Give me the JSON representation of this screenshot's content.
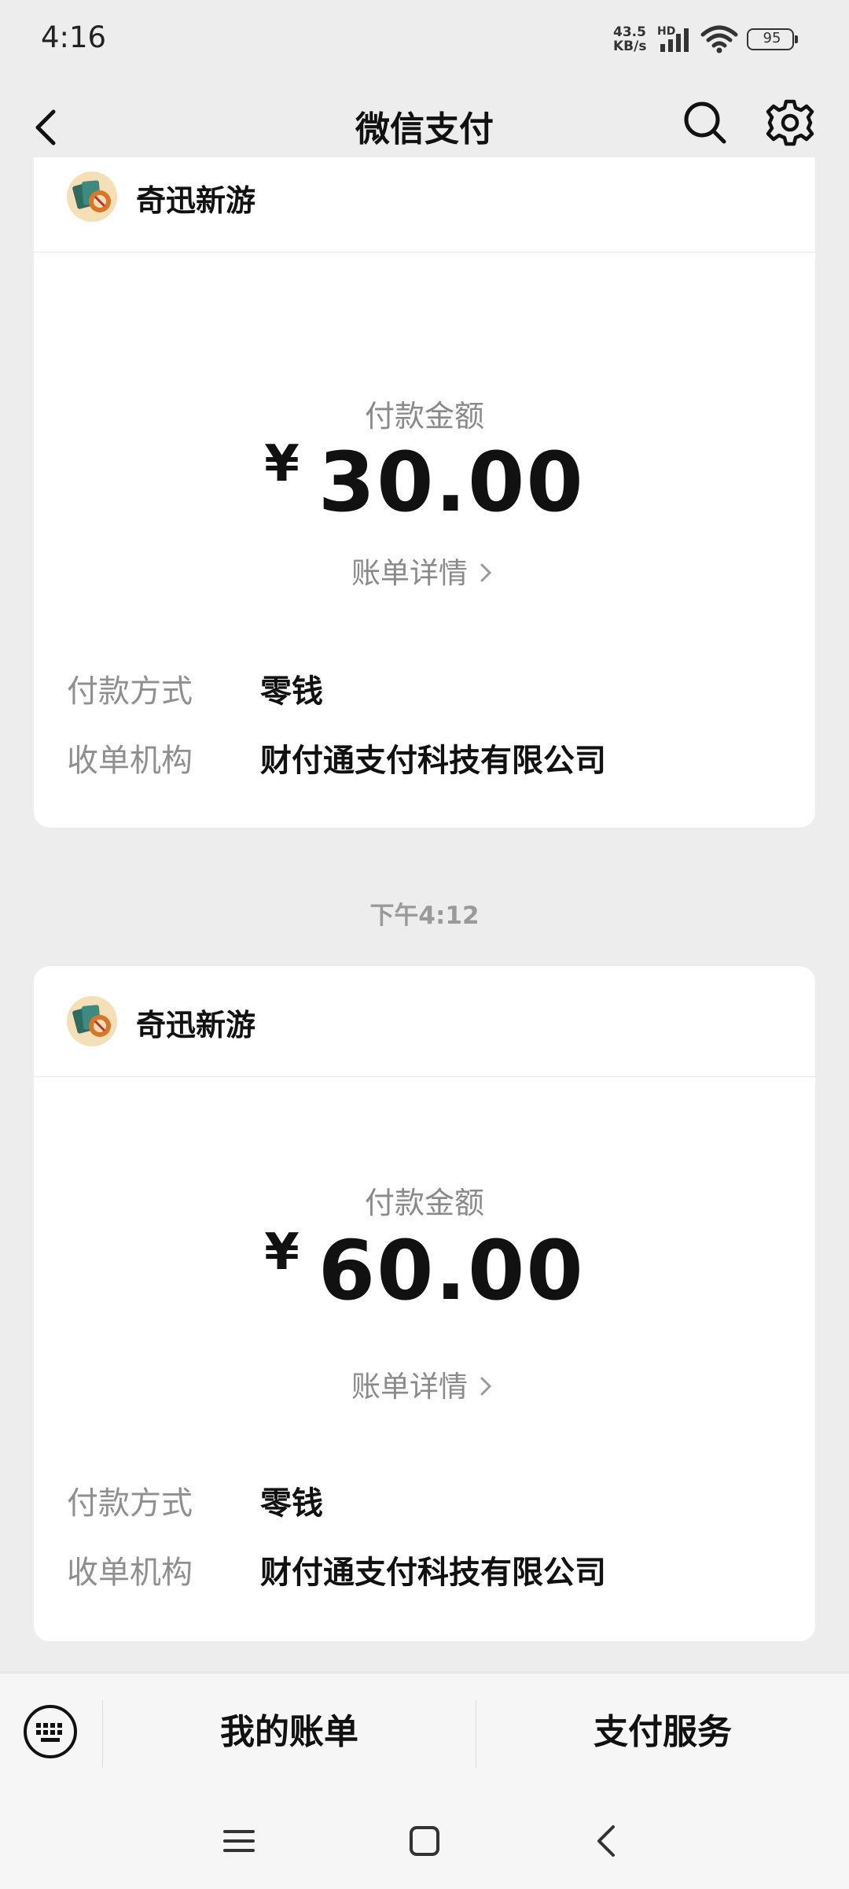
{
  "status_bar": {
    "time": "4:16",
    "net_speed_value": "43.5",
    "net_speed_unit": "KB/s",
    "hd": "HD",
    "battery": "95"
  },
  "nav": {
    "title": "微信支付"
  },
  "timestamp": "下午4:12",
  "cards": [
    {
      "merchant": "奇迅新游",
      "amount_label": "付款金额",
      "currency": "¥",
      "amount": "30.00",
      "detail_link": "账单详情",
      "payment_method_label": "付款方式",
      "payment_method": "零钱",
      "acquirer_label": "收单机构",
      "acquirer": "财付通支付科技有限公司"
    },
    {
      "merchant": "奇迅新游",
      "amount_label": "付款金额",
      "currency": "¥",
      "amount": "60.00",
      "detail_link": "账单详情",
      "payment_method_label": "付款方式",
      "payment_method": "零钱",
      "acquirer_label": "收单机构",
      "acquirer": "财付通支付科技有限公司"
    }
  ],
  "bottom_menu": {
    "my_bills": "我的账单",
    "pay_services": "支付服务"
  },
  "icons": {
    "back": "back-arrow-icon",
    "search": "search-icon",
    "settings": "gear-icon",
    "keyboard": "keyboard-icon",
    "sys_menu": "menu-icon",
    "sys_home": "home-icon",
    "sys_back": "back-icon"
  }
}
